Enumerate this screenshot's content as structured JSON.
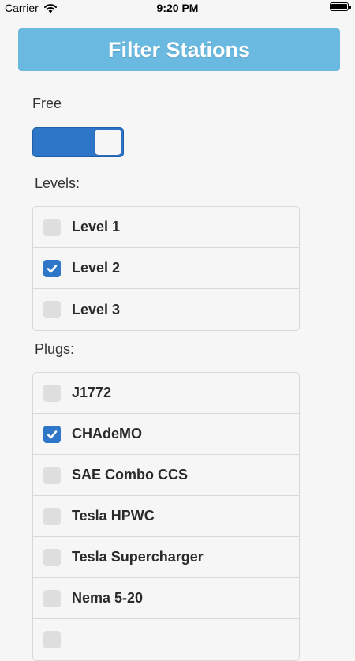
{
  "status_bar": {
    "carrier": "Carrier",
    "time": "9:20 PM"
  },
  "header": {
    "title": "Filter Stations"
  },
  "free": {
    "label": "Free",
    "enabled": true
  },
  "levels": {
    "label": "Levels:",
    "items": [
      {
        "label": "Level 1",
        "checked": false
      },
      {
        "label": "Level 2",
        "checked": true
      },
      {
        "label": "Level 3",
        "checked": false
      }
    ]
  },
  "plugs": {
    "label": "Plugs:",
    "items": [
      {
        "label": "J1772",
        "checked": false
      },
      {
        "label": "CHAdeMO",
        "checked": true
      },
      {
        "label": "SAE Combo CCS",
        "checked": false
      },
      {
        "label": "Tesla HPWC",
        "checked": false
      },
      {
        "label": "Tesla Supercharger",
        "checked": false
      },
      {
        "label": "Nema 5-20",
        "checked": false
      },
      {
        "label": "",
        "checked": false
      }
    ]
  },
  "colors": {
    "accent": "#2e77c8",
    "header": "#69b9e1"
  }
}
